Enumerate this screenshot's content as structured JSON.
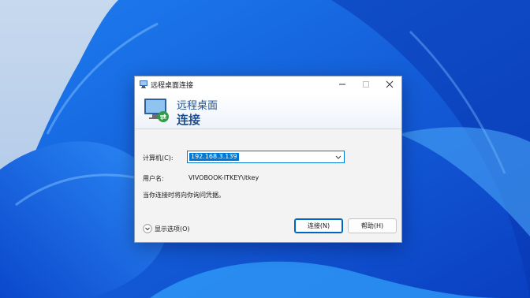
{
  "window": {
    "title": "远程桌面连接",
    "controls": [
      "minimize",
      "maximize",
      "close"
    ]
  },
  "header": {
    "line1": "远程桌面",
    "line2": "连接",
    "icon": "remote-desktop-icon"
  },
  "form": {
    "computer_label": "计算机(C):",
    "computer_value": "192.168.3.139",
    "username_label": "用户名:",
    "username_value": "VIVOBOOK-ITKEY\\itkey",
    "note": "当你连接时将向你询问凭据。"
  },
  "footer": {
    "show_options": "显示选项(O)",
    "connect_button": "连接(N)",
    "help_button": "帮助(H)"
  },
  "colors": {
    "accent": "#0078d7",
    "header_text": "#1e4f8f",
    "dialog_bg": "#f3f3f3",
    "wallpaper_blue": "#1657d8"
  }
}
